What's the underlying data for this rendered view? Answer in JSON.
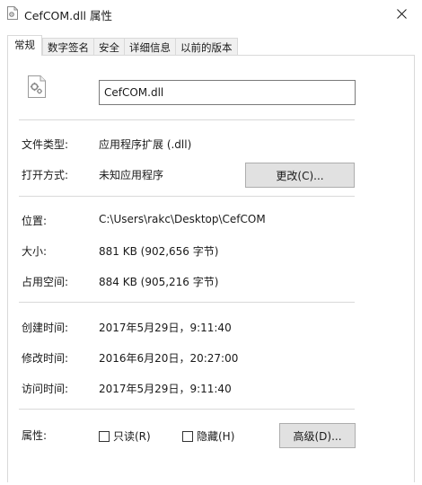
{
  "window": {
    "title": "CefCOM.dll 属性",
    "close_glyph": "✕"
  },
  "tabs": [
    {
      "label": "常规",
      "active": true
    },
    {
      "label": "数字签名",
      "active": false
    },
    {
      "label": "安全",
      "active": false
    },
    {
      "label": "详细信息",
      "active": false
    },
    {
      "label": "以前的版本",
      "active": false
    }
  ],
  "general": {
    "file_name": "CefCOM.dll",
    "file_type": {
      "label": "文件类型:",
      "value": "应用程序扩展 (.dll)"
    },
    "opens_with": {
      "label": "打开方式:",
      "value": "未知应用程序",
      "change_button": "更改(C)..."
    },
    "location": {
      "label": "位置:",
      "value": "C:\\Users\\rakc\\Desktop\\CefCOM"
    },
    "size": {
      "label": "大小:",
      "value": "881 KB (902,656 字节)"
    },
    "size_on_disk": {
      "label": "占用空间:",
      "value": "884 KB (905,216 字节)"
    },
    "created": {
      "label": "创建时间:",
      "value": "2017年5月29日，9:11:40"
    },
    "modified": {
      "label": "修改时间:",
      "value": "2016年6月20日，20:27:00"
    },
    "accessed": {
      "label": "访问时间:",
      "value": "2017年5月29日，9:11:40"
    },
    "attributes": {
      "label": "属性:",
      "readonly": {
        "label": "只读(R)",
        "checked": false
      },
      "hidden": {
        "label": "隐藏(H)",
        "checked": false
      },
      "advanced_button": "高级(D)..."
    }
  },
  "colors": {
    "accent_border": "#d9d9d9",
    "button_bg": "#e1e1e1",
    "input_border": "#7a7a7a"
  },
  "icons": {
    "title": "dll-file-gear-icon",
    "file": "dll-file-gear-icon",
    "close": "close-icon"
  }
}
